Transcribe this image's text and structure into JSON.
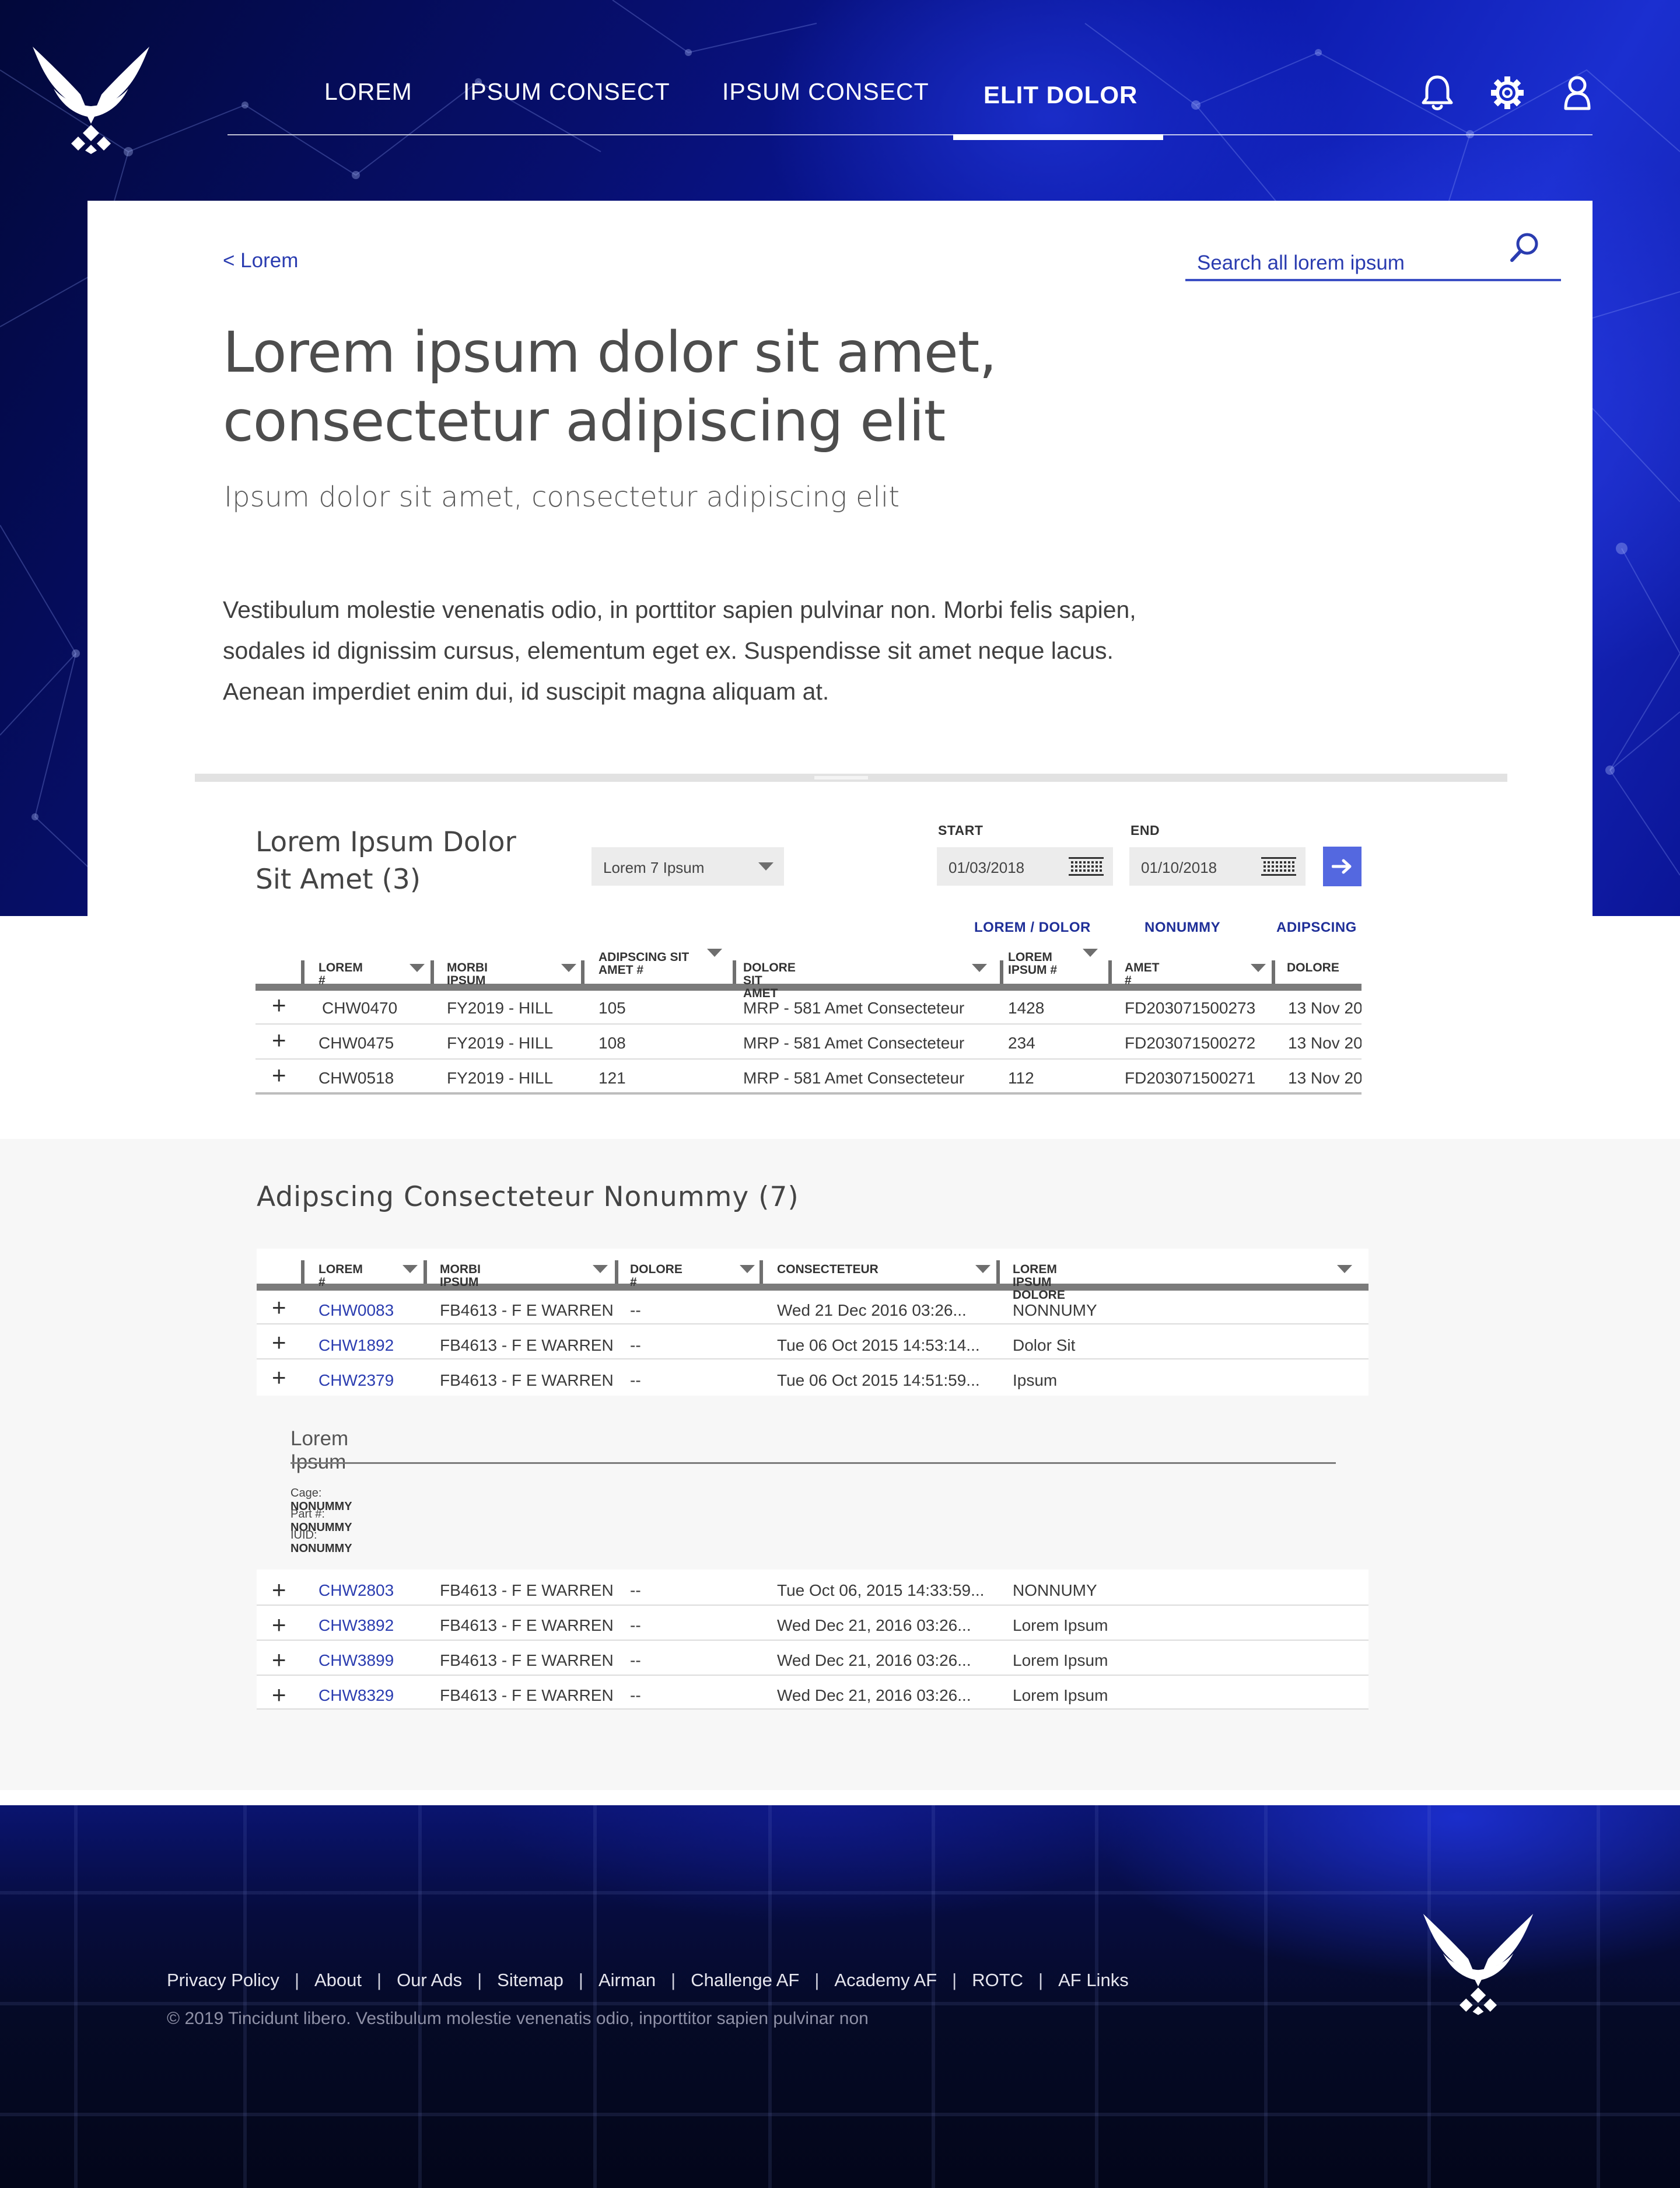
{
  "colors": {
    "brand_blue": "#0a18a8",
    "link_blue": "#2a3cb0",
    "accent_button": "#5468e0",
    "gray_band": "#f7f7f7"
  },
  "nav": {
    "items": [
      "LOREM",
      "IPSUM CONSECT",
      "IPSUM CONSECT",
      "ELIT DOLOR"
    ],
    "active_index": 3,
    "icons": [
      "bell-icon",
      "gear-icon",
      "user-icon"
    ]
  },
  "header": {
    "back_link": "< Lorem",
    "search_placeholder": "Search all lorem ipsum",
    "title": "Lorem ipsum dolor sit amet, consectetur adipiscing elit",
    "subtitle": "Ipsum dolor sit amet, consectetur adipiscing elit",
    "body": "Vestibulum molestie venenatis odio, in porttitor sapien pulvinar non. Morbi felis sapien, sodales id dignissim cursus, elementum eget ex. Suspendisse sit amet neque lacus. Aenean imperdiet enim dui, id suscipit magna aliquam at."
  },
  "section1": {
    "title": "Lorem Ipsum Dolor Sit Amet (3)",
    "select_value": "Lorem 7 Ipsum",
    "start_label": "START",
    "start_value": "01/03/2018",
    "end_label": "END",
    "end_value": "01/10/2018",
    "view_toggles": [
      "LOREM / DOLOR",
      "NONUMMY",
      "ADIPSCING"
    ],
    "columns": [
      "LOREM #",
      "MORBI IPSUM",
      "ADIPSCING SIT AMET #",
      "DOLORE SIT AMET",
      "LOREM IPSUM #",
      "AMET #",
      "DOLORE"
    ],
    "rows": [
      [
        "CHW0470",
        "FY2019 - HILL",
        "105",
        "MRP - 581 Amet Consecteteur",
        "1428",
        "FD203071500273",
        "13 Nov 20"
      ],
      [
        "CHW0475",
        "FY2019 - HILL",
        "108",
        "MRP - 581 Amet Consecteteur",
        "234",
        "FD203071500272",
        "13 Nov 20"
      ],
      [
        "CHW0518",
        "FY2019 - HILL",
        "121",
        "MRP - 581 Amet Consecteteur",
        "112",
        "FD203071500271",
        "13 Nov 20"
      ]
    ]
  },
  "section2": {
    "title": "Adipscing Consecteteur Nonummy (7)",
    "columns": [
      "LOREM #",
      "MORBI IPSUM",
      "DOLORE #",
      "CONSECTETEUR",
      "LOREM IPSUM DOLORE"
    ],
    "rows": [
      [
        "CHW0083",
        "FB4613 - F E WARREN",
        "--",
        "Wed 21 Dec 2016 03:26...",
        "NONNUMY"
      ],
      [
        "CHW1892",
        "FB4613 - F E WARREN",
        "--",
        "Tue 06 Oct 2015 14:53:14...",
        "Dolor Sit"
      ],
      [
        "CHW2379",
        "FB4613 - F E WARREN",
        "--",
        "Tue 06 Oct 2015 14:51:59...",
        "Ipsum"
      ],
      [
        "CHW2803",
        "FB4613 - F E WARREN",
        "--",
        "Tue Oct 06, 2015 14:33:59...",
        "NONNUMY"
      ],
      [
        "CHW3892",
        "FB4613 - F E WARREN",
        "--",
        "Wed Dec 21, 2016 03:26...",
        "Lorem Ipsum"
      ],
      [
        "CHW3899",
        "FB4613 - F E WARREN",
        "--",
        "Wed Dec 21, 2016 03:26...",
        "Lorem Ipsum"
      ],
      [
        "CHW8329",
        "FB4613 - F E WARREN",
        "--",
        "Wed Dec 21, 2016 03:26...",
        "Lorem Ipsum"
      ]
    ],
    "detail": {
      "title": "Lorem Ipsum",
      "fields": [
        {
          "label": "Cage:",
          "value": "NONUMMY"
        },
        {
          "label": "Part #:",
          "value": "NONUMMY"
        },
        {
          "label": "IUID:",
          "value": "NONUMMY"
        }
      ]
    }
  },
  "footer": {
    "links": [
      "Privacy Policy",
      "About",
      "Our Ads",
      "Sitemap",
      "Airman",
      "Challenge AF",
      "Academy AF",
      "ROTC",
      "AF Links"
    ],
    "copyright": "© 2019 Tincidunt libero. Vestibulum molestie venenatis odio, inporttitor sapien pulvinar non"
  }
}
